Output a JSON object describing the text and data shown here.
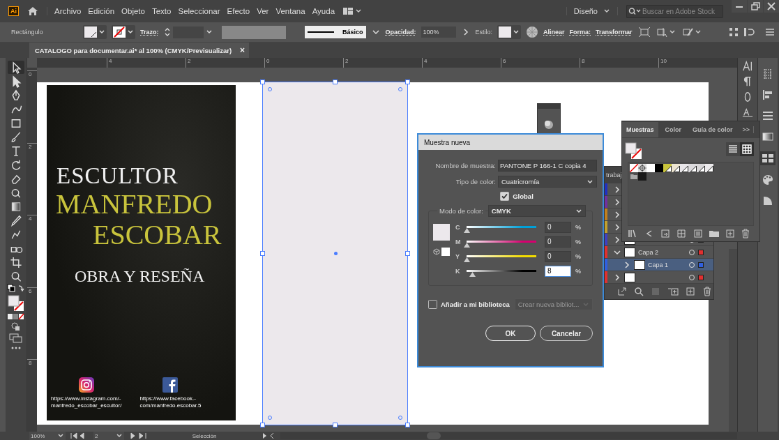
{
  "app_logo": "Ai",
  "menu": [
    "Archivo",
    "Edición",
    "Objeto",
    "Texto",
    "Seleccionar",
    "Efecto",
    "Ver",
    "Ventana",
    "Ayuda"
  ],
  "workspace": "Diseño",
  "stock_search": {
    "placeholder": "Buscar en Adobe Stock"
  },
  "control_bar": {
    "object_type": "Rectángulo",
    "stroke_label": "Trazo:",
    "brush": "Básico",
    "opacity_label": "Opacidad:",
    "opacity": "100%",
    "style_label": "Estilo:",
    "links": [
      "Alinear",
      "Forma:",
      "Transformar"
    ]
  },
  "document_tab": {
    "title": "CATALOGO para documentar.ai* al 100% (CMYK/Previsualizar)",
    "close": "×"
  },
  "rulers": {
    "horizontal": [
      "4",
      "2",
      "0",
      "2",
      "4",
      "6",
      "8",
      "10"
    ],
    "vertical": [
      "0",
      "2",
      "4",
      "6",
      "8"
    ]
  },
  "tools": [
    {
      "kind": "selection",
      "selected": true
    },
    {
      "kind": "direct",
      "selected": false
    },
    {
      "kind": "pen",
      "selected": false
    },
    {
      "kind": "curvature",
      "selected": false
    },
    {
      "kind": "rectangle",
      "selected": false
    },
    {
      "kind": "brush",
      "selected": false
    },
    {
      "kind": "type",
      "selected": false
    },
    {
      "kind": "rotate",
      "selected": false
    },
    {
      "kind": "eraser",
      "selected": false
    },
    {
      "kind": "shapebuilder",
      "selected": false
    },
    {
      "kind": "gradient",
      "selected": false
    },
    {
      "kind": "eyedropper",
      "selected": false
    },
    {
      "kind": "puppet",
      "selected": false
    },
    {
      "kind": "blend",
      "selected": false
    },
    {
      "kind": "artboard",
      "selected": false
    },
    {
      "kind": "zoom",
      "selected": false
    }
  ],
  "cover": {
    "title": "ESCULTOR",
    "name_lines": [
      "MANFREDO",
      "ESCOBAR"
    ],
    "subtitle": "OBRA Y RESEÑA",
    "social": [
      {
        "kind": "instagram",
        "url_lines": [
          "https://www.instagram.com/-",
          "manfredo_escobar_escultor/"
        ]
      },
      {
        "kind": "facebook",
        "url_lines": [
          "https://www.facebook.-",
          "com/manfredo.escobar.5"
        ]
      }
    ]
  },
  "dialog": {
    "title": "Muestra nueva",
    "name_label": "Nombre de muestra:",
    "name_value": "PANTONE P 166-1 C copia 4",
    "type_label": "Tipo de color:",
    "type_value": "Cuatricromía",
    "global": {
      "label": "Global",
      "checked": true
    },
    "mode_label": "Modo de color:",
    "mode_value": "CMYK",
    "channels": [
      {
        "name": "C",
        "color": "#00a0d8",
        "level": 0,
        "value": "0",
        "unit": "%",
        "focused": false
      },
      {
        "name": "M",
        "color": "#d6006f",
        "level": 0,
        "value": "0",
        "unit": "%",
        "focused": false
      },
      {
        "name": "Y",
        "color": "#f2dc00",
        "level": 0,
        "value": "0",
        "unit": "%",
        "focused": false
      },
      {
        "name": "K",
        "color": "#000000",
        "level": 0.08,
        "value": "8",
        "unit": "%",
        "focused": true
      }
    ],
    "library": {
      "label": "Añadir a mi biblioteca",
      "checked": false
    },
    "library_select": {
      "value": "Crear nueva bibliot...",
      "disabled": true
    },
    "buttons": [
      "OK",
      "Cancelar"
    ]
  },
  "swatches_panel": {
    "tabs": [
      {
        "label": "Muestras",
        "selected": true
      },
      {
        "label": "Color",
        "selected": false
      },
      {
        "label": "Guía de color",
        "selected": false
      }
    ],
    "more": ">>",
    "views": [
      {
        "kind": "list",
        "selected": false
      },
      {
        "kind": "grid",
        "selected": true
      }
    ],
    "swatches": [
      {
        "kind": "none",
        "global": false
      },
      {
        "kind": "registration",
        "global": false
      },
      {
        "kind": "color",
        "color": "#ffffff",
        "global": false
      },
      {
        "kind": "color",
        "color": "#000000",
        "global": false
      },
      {
        "kind": "color",
        "color": "#c9c43c",
        "global": true
      },
      {
        "kind": "color",
        "color": "#ece4d0",
        "global": true
      },
      {
        "kind": "color",
        "color": "#e8e6e9",
        "global": true
      },
      {
        "kind": "color",
        "color": "#dcdadd",
        "global": true
      },
      {
        "kind": "color",
        "color": "#d8d6d8",
        "global": true
      },
      {
        "kind": "color",
        "color": "#eceaec",
        "global": true
      },
      {
        "kind": "folder",
        "global": false
      },
      {
        "kind": "color",
        "color": "#1a1a1a",
        "global": false
      }
    ]
  },
  "layers_panel": {
    "tab": "trabaj",
    "layers": [
      {
        "color": "#2030c0",
        "expanded": false,
        "selected": false
      },
      {
        "color": "#7030a0",
        "expanded": false,
        "selected": false
      },
      {
        "color": "#c08020",
        "expanded": false,
        "selected": false
      },
      {
        "color": "#c0a030",
        "expanded": false,
        "selected": false
      },
      {
        "color": "#4040c0",
        "expanded": false,
        "selected": false
      },
      {
        "name": "Capa 2",
        "color": "#e03030",
        "expanded": true,
        "selected": false,
        "children": [
          {
            "name": "Capa 1",
            "color": "#3060e0",
            "expanded": false,
            "selected": true
          }
        ]
      },
      {
        "color": "#e03030",
        "expanded": false,
        "selected": false
      }
    ]
  },
  "status_bar": {
    "zoom": "100%",
    "page": "2",
    "tool": "Selección"
  }
}
